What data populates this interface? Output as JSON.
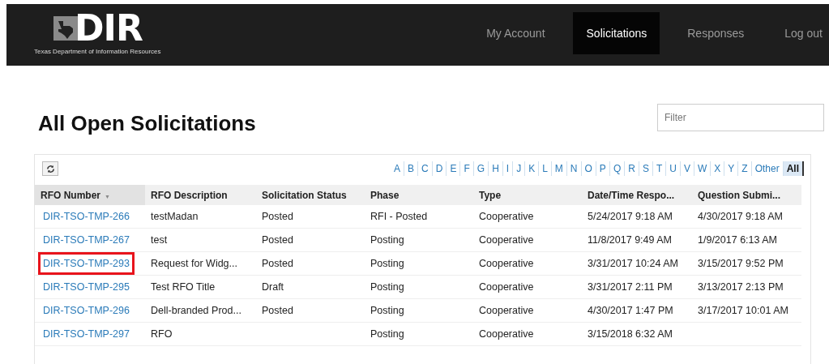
{
  "header": {
    "logo_text": "DIR",
    "tagline": "Texas Department of Information Resources",
    "nav": [
      {
        "label": "My Account",
        "selected": false
      },
      {
        "label": "Solicitations",
        "selected": true
      },
      {
        "label": "Responses",
        "selected": false
      },
      {
        "label": "Log out",
        "selected": false
      }
    ]
  },
  "title": "All Open Solicitations",
  "filter": {
    "placeholder": "Filter"
  },
  "letters": [
    {
      "label": "A",
      "selected": false
    },
    {
      "label": "B",
      "selected": false
    },
    {
      "label": "C",
      "selected": false
    },
    {
      "label": "D",
      "selected": false
    },
    {
      "label": "E",
      "selected": false
    },
    {
      "label": "F",
      "selected": false
    },
    {
      "label": "G",
      "selected": false
    },
    {
      "label": "H",
      "selected": false
    },
    {
      "label": "I",
      "selected": false
    },
    {
      "label": "J",
      "selected": false
    },
    {
      "label": "K",
      "selected": false
    },
    {
      "label": "L",
      "selected": false
    },
    {
      "label": "M",
      "selected": false
    },
    {
      "label": "N",
      "selected": false
    },
    {
      "label": "O",
      "selected": false
    },
    {
      "label": "P",
      "selected": false
    },
    {
      "label": "Q",
      "selected": false
    },
    {
      "label": "R",
      "selected": false
    },
    {
      "label": "S",
      "selected": false
    },
    {
      "label": "T",
      "selected": false
    },
    {
      "label": "U",
      "selected": false
    },
    {
      "label": "V",
      "selected": false
    },
    {
      "label": "W",
      "selected": false
    },
    {
      "label": "X",
      "selected": false
    },
    {
      "label": "Y",
      "selected": false
    },
    {
      "label": "Z",
      "selected": false
    },
    {
      "label": "Other",
      "selected": false
    },
    {
      "label": "All",
      "selected": true
    }
  ],
  "table": {
    "columns": [
      {
        "label": "RFO Number",
        "sorted": true,
        "sort_glyph": "▼"
      },
      {
        "label": "RFO Description",
        "sorted": false
      },
      {
        "label": "Solicitation Status",
        "sorted": false
      },
      {
        "label": "Phase",
        "sorted": false
      },
      {
        "label": "Type",
        "sorted": false
      },
      {
        "label": "Date/Time Respo...",
        "sorted": false
      },
      {
        "label": "Question Submi...",
        "sorted": false
      }
    ],
    "rows": [
      {
        "highlighted": false,
        "cells": [
          "DIR-TSO-TMP-266",
          "testMadan",
          "Posted",
          "RFI - Posted",
          "Cooperative",
          "5/24/2017 9:18 AM",
          "4/30/2017 9:18 AM"
        ]
      },
      {
        "highlighted": false,
        "cells": [
          "DIR-TSO-TMP-267",
          "test",
          "Posted",
          "Posting",
          "Cooperative",
          "11/8/2017 9:49 AM",
          "1/9/2017 6:13 AM"
        ]
      },
      {
        "highlighted": true,
        "cells": [
          "DIR-TSO-TMP-293",
          "Request for Widg...",
          "Posted",
          "Posting",
          "Cooperative",
          "3/31/2017 10:24 AM",
          "3/15/2017 9:52 PM"
        ]
      },
      {
        "highlighted": false,
        "cells": [
          "DIR-TSO-TMP-295",
          "Test RFO Title",
          "Draft",
          "Posting",
          "Cooperative",
          "3/31/2017 2:11 PM",
          "3/13/2017 2:13 PM"
        ]
      },
      {
        "highlighted": false,
        "cells": [
          "DIR-TSO-TMP-296",
          "Dell-branded Prod...",
          "Posted",
          "Posting",
          "Cooperative",
          "4/30/2017 1:47 PM",
          "3/17/2017 10:01 AM"
        ]
      },
      {
        "highlighted": false,
        "cells": [
          "DIR-TSO-TMP-297",
          "RFO",
          null,
          "Posting",
          "Cooperative",
          "3/15/2018 6:32 AM",
          null
        ]
      }
    ]
  }
}
